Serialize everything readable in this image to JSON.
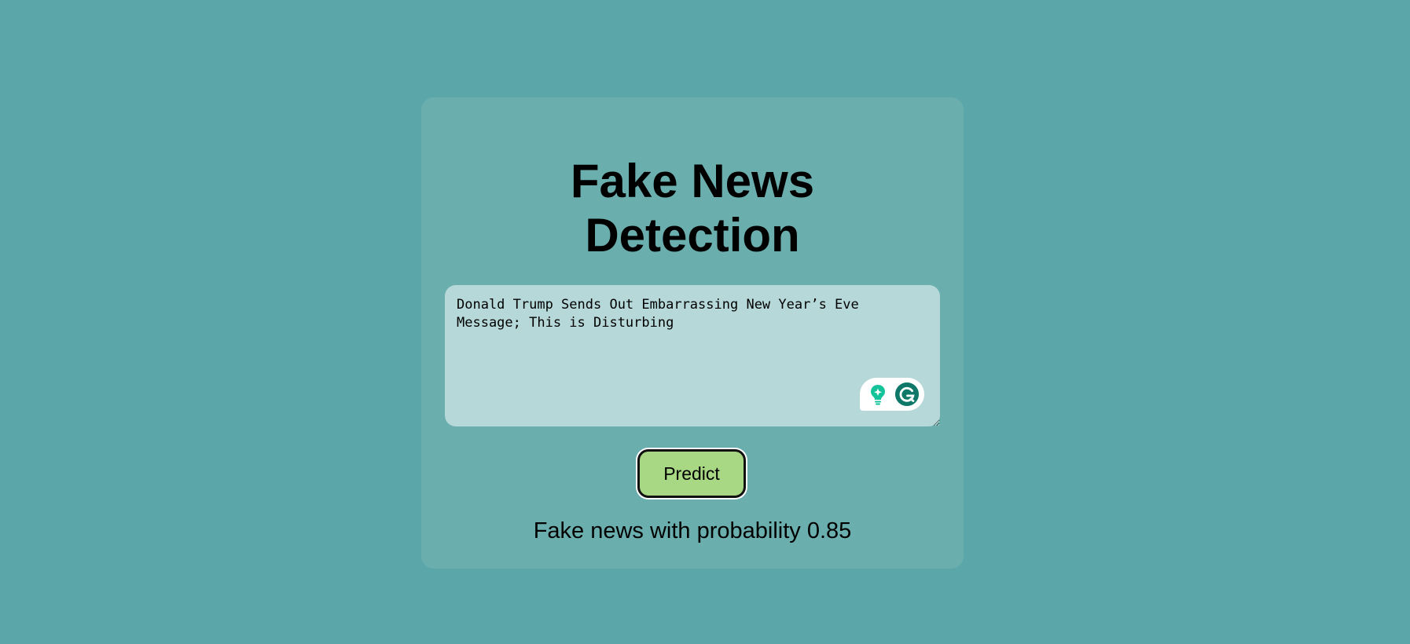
{
  "title_lines": [
    "Fake News",
    "Detection"
  ],
  "input": {
    "value": "Donald Trump Sends Out Embarrassing New Year’s Eve Message; This is Disturbing",
    "placeholder": ""
  },
  "grammarly": {
    "icons": [
      "lightbulb-sparkle-icon",
      "grammarly-g-icon"
    ]
  },
  "predict_label": "Predict",
  "result_text": "Fake news with probability 0.85",
  "colors": {
    "background": "#5aa6a8",
    "card": "#6aafae",
    "textarea": "#b6d8d9",
    "button": "#a8d883",
    "grammarly_green": "#15c39a",
    "grammarly_dark": "#0f7868"
  }
}
